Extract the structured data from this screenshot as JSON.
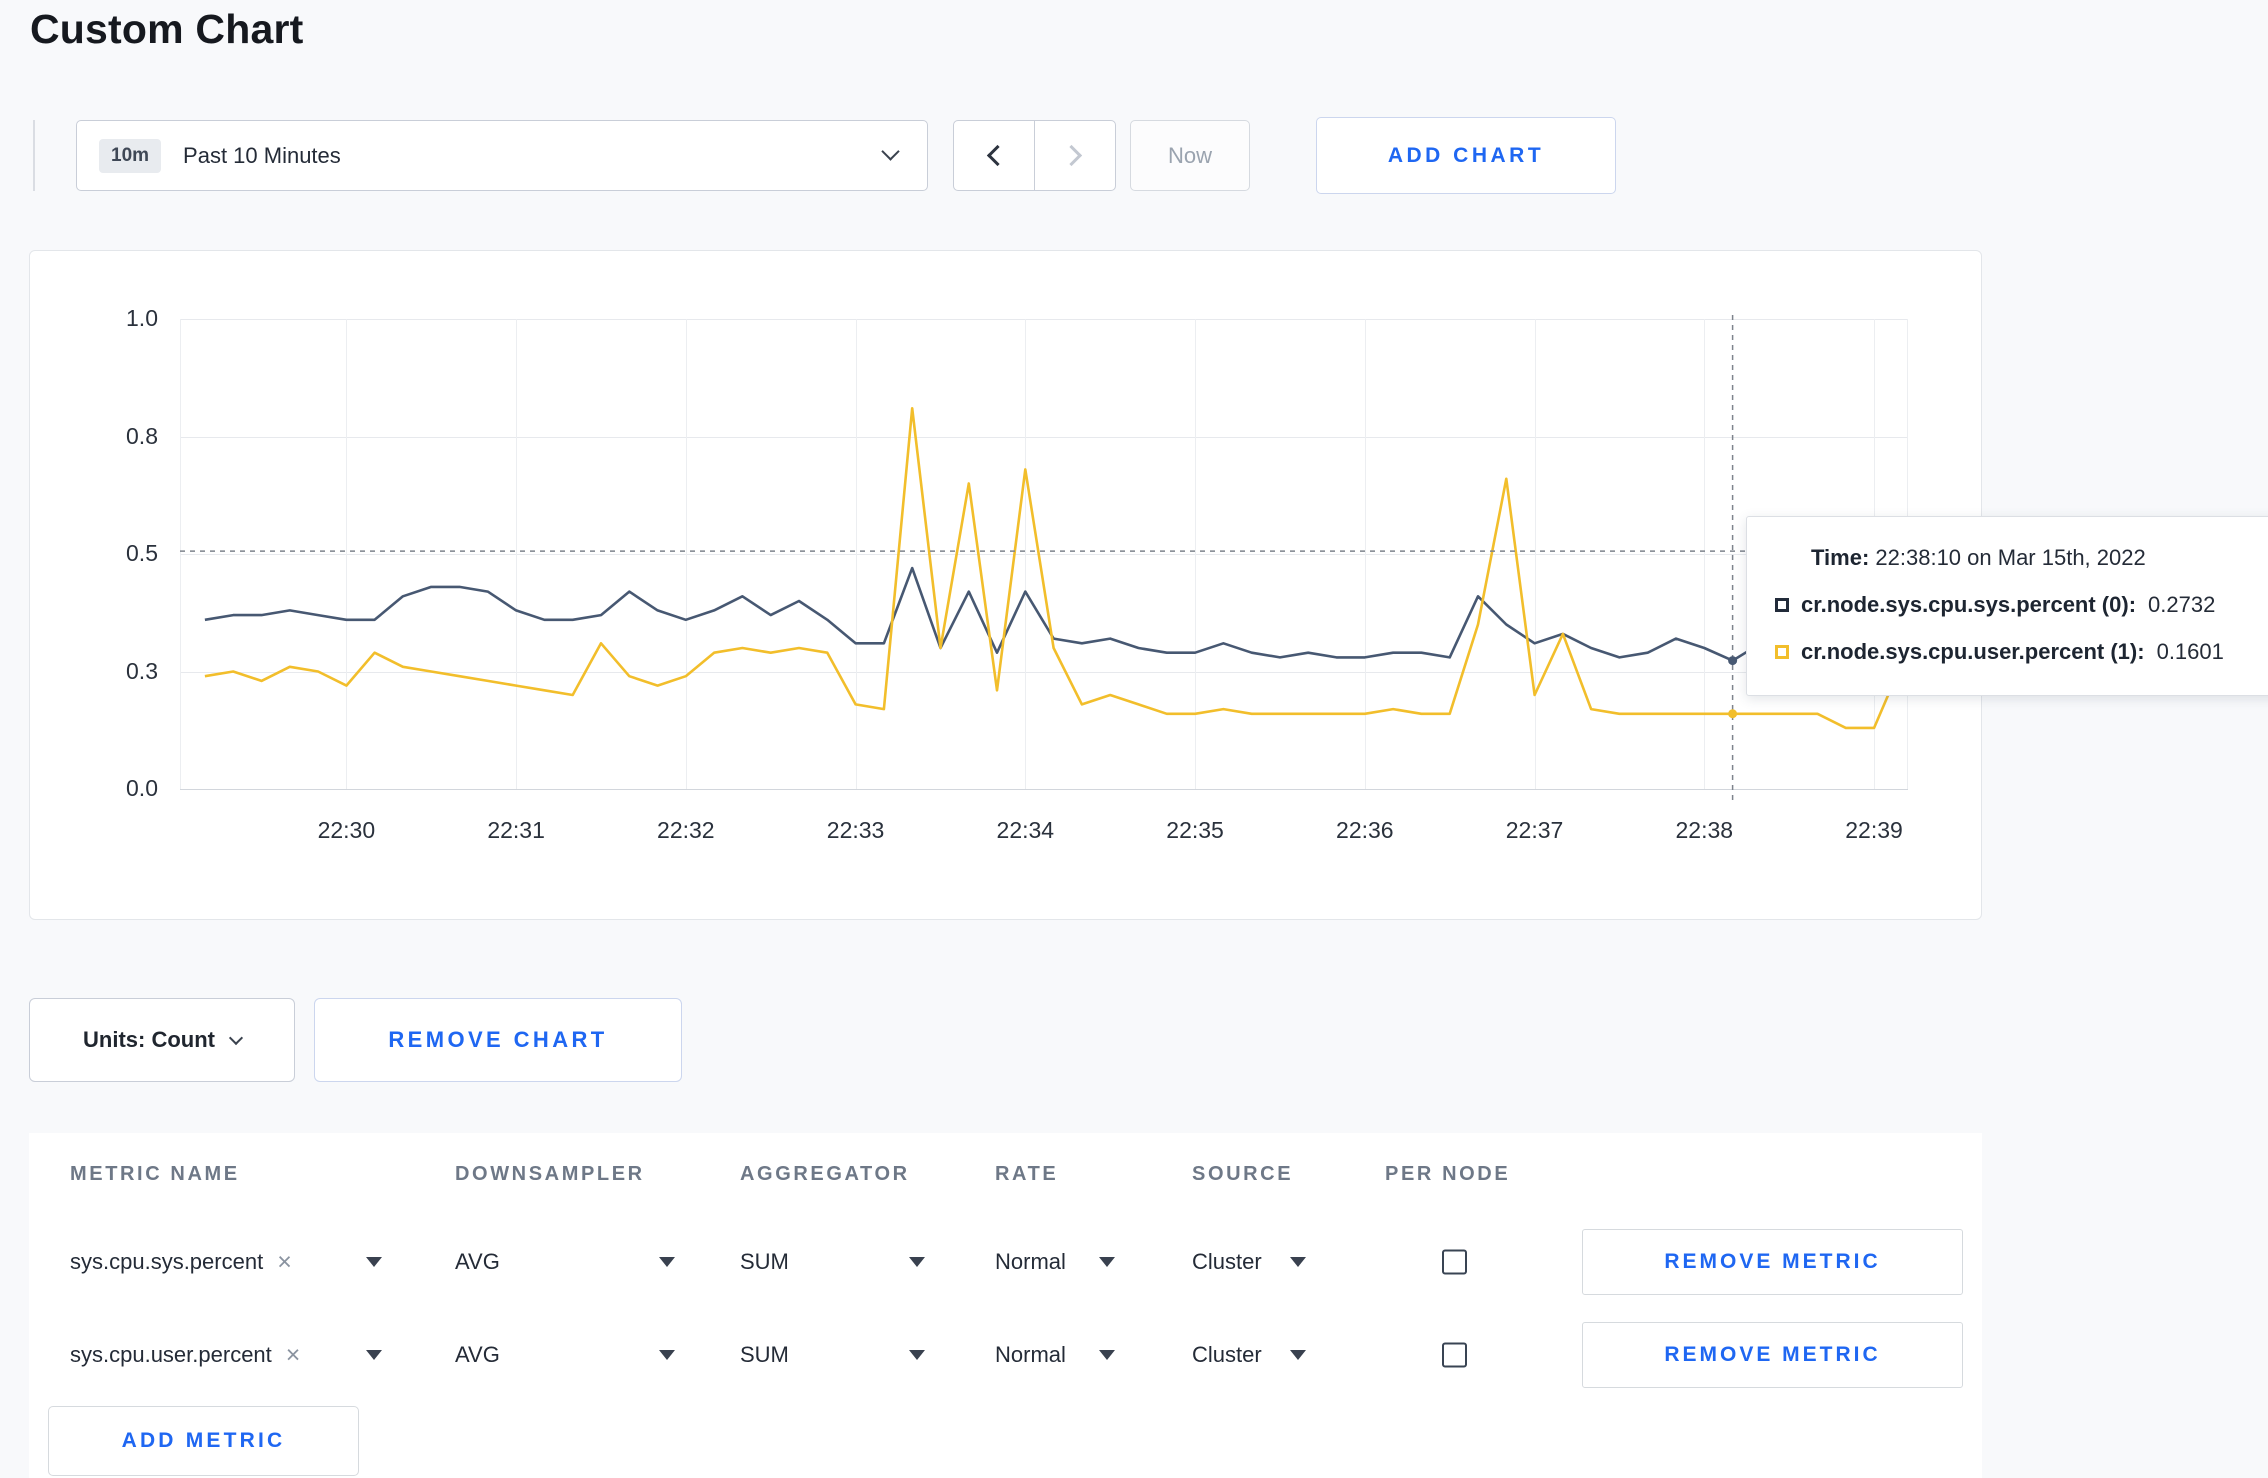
{
  "page": {
    "title": "Custom Chart",
    "background_color": "#f8f9fb",
    "accent_color": "#1f67f2"
  },
  "icons": {
    "clear_x": "×"
  },
  "toolbar": {
    "time_badge": "10m",
    "time_range_label": "Past 10 Minutes",
    "now_label": "Now",
    "add_chart_label": "ADD CHART"
  },
  "chart": {
    "tooltip": {
      "time_label": "Time:",
      "time_value": "22:38:10 on Mar 15th, 2022",
      "series": [
        {
          "label": "cr.node.sys.cpu.sys.percent (0):",
          "value": "0.2732",
          "color": "#222b3a"
        },
        {
          "label": "cr.node.sys.cpu.user.percent (1):",
          "value": "0.1601",
          "color": "#f2be2b"
        }
      ]
    }
  },
  "units_row": {
    "units_label": "Units: Count",
    "remove_chart_label": "REMOVE CHART"
  },
  "metrics_table": {
    "headers": [
      "METRIC NAME",
      "DOWNSAMPLER",
      "AGGREGATOR",
      "RATE",
      "SOURCE",
      "PER NODE"
    ],
    "rows": [
      {
        "metric": "sys.cpu.sys.percent",
        "downsampler": "AVG",
        "aggregator": "SUM",
        "rate": "Normal",
        "source": "Cluster",
        "per_node": false,
        "remove_label": "REMOVE METRIC"
      },
      {
        "metric": "sys.cpu.user.percent",
        "downsampler": "AVG",
        "aggregator": "SUM",
        "rate": "Normal",
        "source": "Cluster",
        "per_node": false,
        "remove_label": "REMOVE METRIC"
      }
    ],
    "add_metric_label": "ADD METRIC"
  },
  "chart_data": {
    "type": "line",
    "title": "",
    "xlabel": "",
    "ylabel": "",
    "grid": true,
    "legend_position": "tooltip-only",
    "x_axis": {
      "tick_labels": [
        "22:30",
        "22:31",
        "22:32",
        "22:33",
        "22:34",
        "22:35",
        "22:36",
        "22:37",
        "22:38",
        "22:39"
      ],
      "tick_minutes": [
        0,
        1,
        2,
        3,
        4,
        5,
        6,
        7,
        8,
        9
      ],
      "domain_minutes": [
        -0.98,
        9.2
      ]
    },
    "y_axis": {
      "ylim": [
        0,
        1
      ],
      "ticks": [
        {
          "value": 0,
          "label": "0.0"
        },
        {
          "value": 0.25,
          "label": "0.3"
        },
        {
          "value": 0.5,
          "label": "0.5"
        },
        {
          "value": 0.75,
          "label": "0.8"
        },
        {
          "value": 1,
          "label": "1.0"
        }
      ]
    },
    "sample_start_time": "22:29:10",
    "sample_start_minutes": -0.8333,
    "sample_step_minutes": 0.1666667,
    "series": [
      {
        "name": "cr.node.sys.cpu.sys.percent",
        "color": "#475872",
        "values": [
          0.36,
          0.37,
          0.37,
          0.38,
          0.37,
          0.36,
          0.36,
          0.41,
          0.43,
          0.43,
          0.42,
          0.38,
          0.36,
          0.36,
          0.37,
          0.42,
          0.38,
          0.36,
          0.38,
          0.41,
          0.37,
          0.4,
          0.36,
          0.31,
          0.31,
          0.47,
          0.3,
          0.42,
          0.29,
          0.42,
          0.32,
          0.31,
          0.32,
          0.3,
          0.29,
          0.29,
          0.31,
          0.29,
          0.28,
          0.29,
          0.28,
          0.28,
          0.29,
          0.29,
          0.28,
          0.41,
          0.35,
          0.31,
          0.33,
          0.3,
          0.28,
          0.29,
          0.32,
          0.3,
          0.2732,
          0.31,
          0.3,
          0.31,
          0.31,
          0.3,
          0.3
        ]
      },
      {
        "name": "cr.node.sys.cpu.user.percent",
        "color": "#f2be2b",
        "values": [
          0.24,
          0.25,
          0.23,
          0.26,
          0.25,
          0.22,
          0.29,
          0.26,
          0.25,
          0.24,
          0.23,
          0.22,
          0.21,
          0.2,
          0.31,
          0.24,
          0.22,
          0.24,
          0.29,
          0.3,
          0.29,
          0.3,
          0.29,
          0.18,
          0.17,
          0.81,
          0.3,
          0.65,
          0.21,
          0.68,
          0.3,
          0.18,
          0.2,
          0.18,
          0.16,
          0.16,
          0.17,
          0.16,
          0.16,
          0.16,
          0.16,
          0.16,
          0.17,
          0.16,
          0.16,
          0.35,
          0.66,
          0.2,
          0.33,
          0.17,
          0.16,
          0.16,
          0.16,
          0.16,
          0.1601,
          0.16,
          0.16,
          0.16,
          0.13,
          0.13,
          0.27
        ]
      }
    ],
    "crosshair": {
      "time": "22:38:10",
      "x_minutes": 8.1667,
      "guideline_value": 0.506,
      "points": [
        {
          "series_index": 0,
          "value": 0.2732
        },
        {
          "series_index": 1,
          "value": 0.1601
        }
      ]
    }
  }
}
